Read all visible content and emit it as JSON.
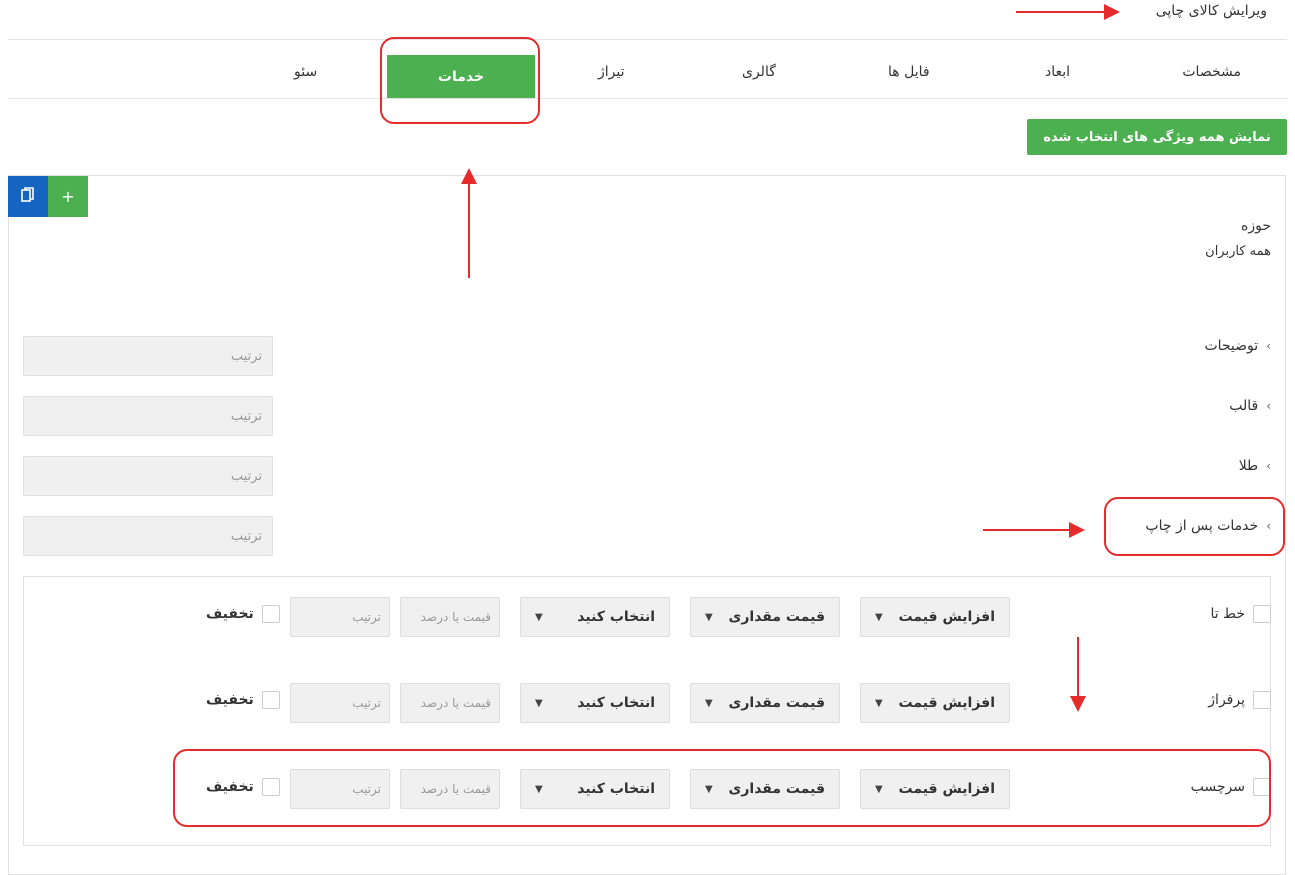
{
  "page": {
    "title": "ویرایش کالای چاپی"
  },
  "tabs": [
    {
      "label": "مشخصات"
    },
    {
      "label": "ابعاد"
    },
    {
      "label": "فایل ها"
    },
    {
      "label": "گالری"
    },
    {
      "label": "تیراژ"
    },
    {
      "label": "خدمات",
      "active": true
    },
    {
      "label": "سئو"
    }
  ],
  "toolbar": {
    "show_all_label": "نمایش همه ویژگی های انتخاب شده",
    "add_label": "+"
  },
  "scope": {
    "label": "حوزه",
    "value": "همه کاربران"
  },
  "sections": [
    {
      "title": "توضیحات",
      "order_placeholder": "ترتیب"
    },
    {
      "title": "قالب",
      "order_placeholder": "ترتیب"
    },
    {
      "title": "طلا",
      "order_placeholder": "ترتیب"
    },
    {
      "title": "خدمات پس از چاپ",
      "order_placeholder": "ترتیب"
    }
  ],
  "service_rows": [
    {
      "name": "خط تا",
      "price_action": "افزایش قیمت",
      "price_type": "قیمت مقداری",
      "select_placeholder": "انتخاب کنید",
      "value_placeholder": "قیمت یا درصد",
      "order_placeholder": "ترتیب",
      "discount_label": "تخفیف"
    },
    {
      "name": "پرفراژ",
      "price_action": "افزایش قیمت",
      "price_type": "قیمت مقداری",
      "select_placeholder": "انتخاب کنید",
      "value_placeholder": "قیمت یا درصد",
      "order_placeholder": "ترتیب",
      "discount_label": "تخفیف"
    },
    {
      "name": "سرچسب",
      "price_action": "افزایش قیمت",
      "price_type": "قیمت مقداری",
      "select_placeholder": "انتخاب کنید",
      "value_placeholder": "قیمت یا درصد",
      "order_placeholder": "ترتیب",
      "discount_label": "تخفیف"
    }
  ],
  "colors": {
    "primary_green": "#4caf50",
    "copy_blue": "#1565c0",
    "annotation_red": "#e52b2b"
  },
  "icons": {
    "copy": "copy-icon",
    "add": "plus-icon",
    "chevron": "chevron-left-icon",
    "dropdown": "caret-down-icon"
  }
}
